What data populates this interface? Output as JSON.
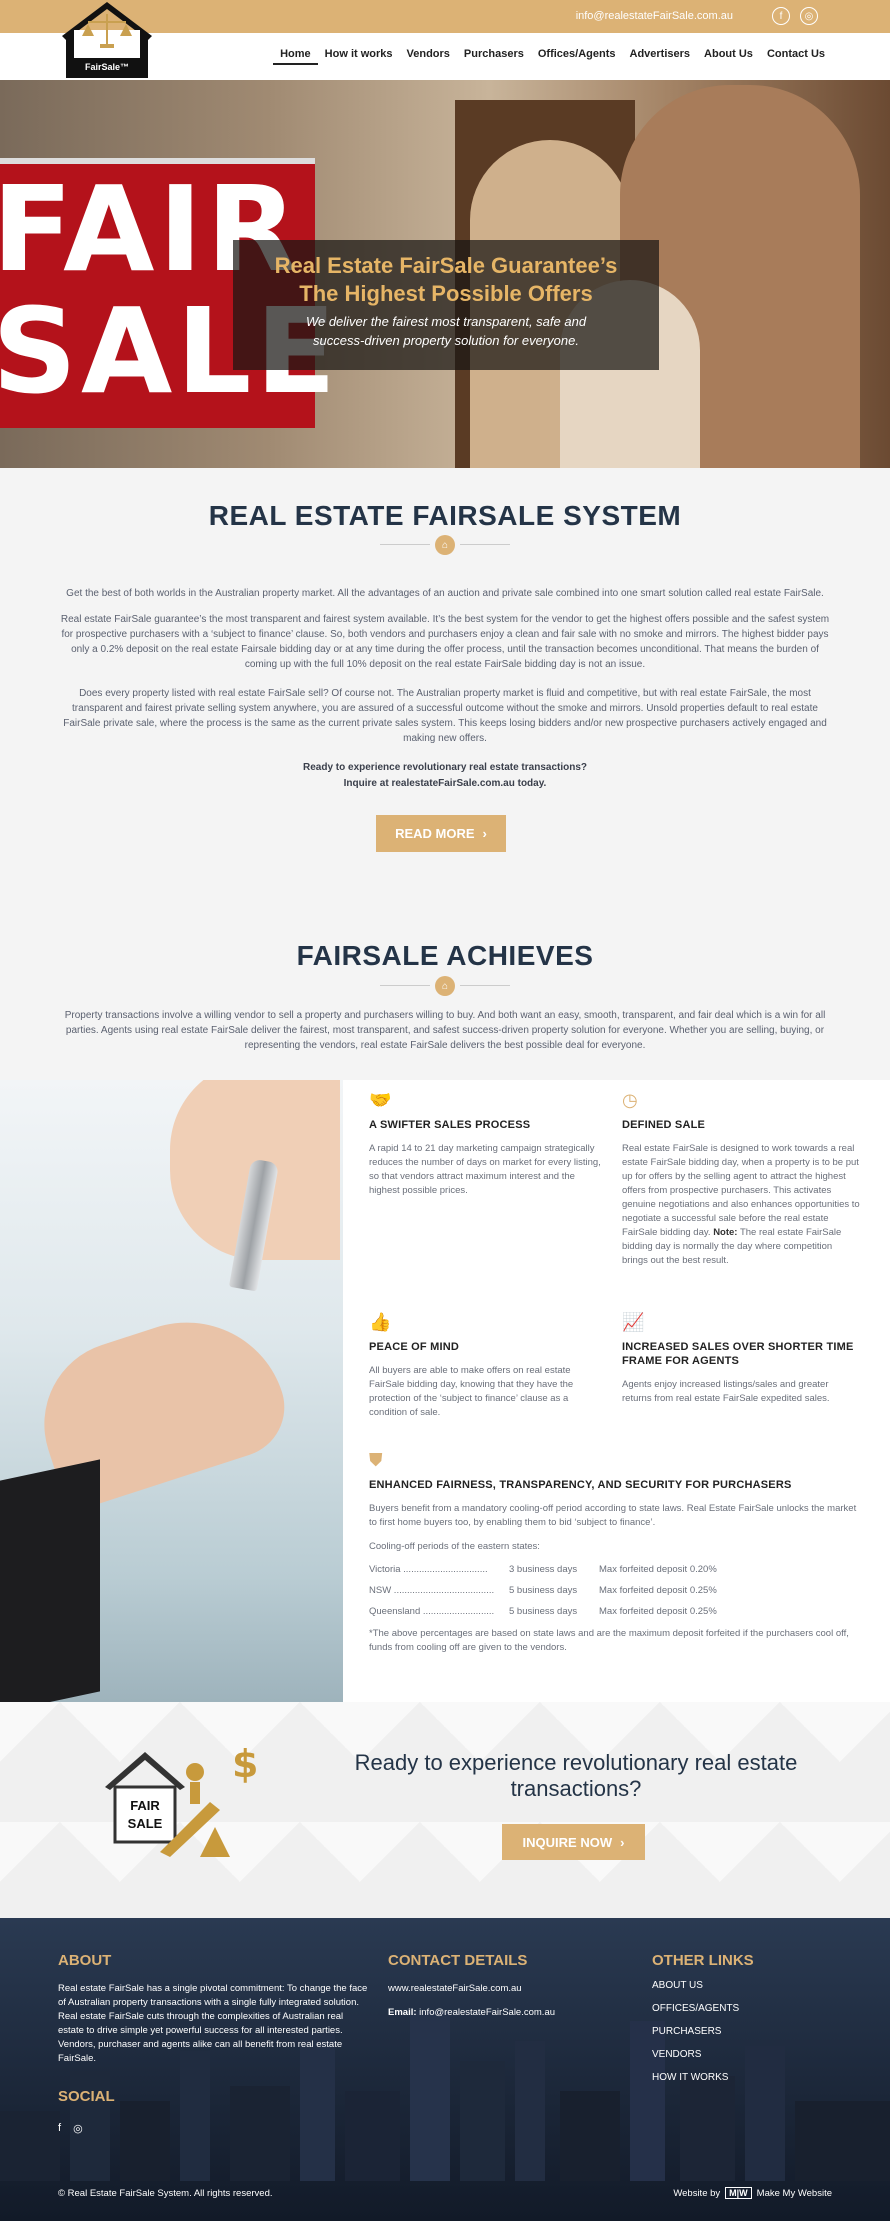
{
  "topbar": {
    "email": "info@realestateFairSale.com.au",
    "social_icons": [
      "facebook-icon",
      "instagram-icon"
    ]
  },
  "logo": {
    "text": "FairSale™"
  },
  "nav": {
    "items": [
      "Home",
      "How it works",
      "Vendors",
      "Purchasers",
      "Offices/Agents",
      "Advertisers",
      "About Us",
      "Contact Us"
    ],
    "active": "Home"
  },
  "hero": {
    "sign_line1": "FAIR",
    "sign_line2": "SALE",
    "title_line1": "Real Estate FairSale Guarantee’s",
    "title_line2": "The Highest Possible Offers",
    "subtitle_line1": "We deliver the fairest most transparent, safe and",
    "subtitle_line2": "success-driven property solution for everyone."
  },
  "system": {
    "title": "REAL ESTATE FAIRSALE SYSTEM",
    "p1": "Get the best of both worlds in the Australian property market. All the advantages of an auction and private sale combined into one smart solution called real estate FairSale.",
    "p2": "Real estate FairSale guarantee’s the most transparent and fairest system available. It’s the best system for the vendor to get the highest offers possible and the safest system for prospective purchasers with a ‘subject to finance’ clause. So, both vendors and purchasers enjoy a clean and fair sale with no smoke and mirrors. The highest bidder pays only a 0.2% deposit on the real estate Fairsale bidding day or at any time during the offer process, until the transaction becomes unconditional. That means the burden of coming up with the full 10% deposit on the real estate FairSale bidding day is not an issue.",
    "p3": "Does every property listed with real estate FairSale sell? Of course not. The Australian property market is fluid and competitive, but with real estate FairSale, the most transparent and fairest private selling system anywhere, you are assured of a successful outcome without the smoke and mirrors. Unsold properties default to real estate FairSale private sale, where the process is the same as the current private sales system. This keeps losing bidders and/or new prospective purchasers actively engaged and making new offers.",
    "bold1": "Ready to experience revolutionary real estate transactions?",
    "bold2": "Inquire at realestateFairSale.com.au today.",
    "button": "READ MORE"
  },
  "achieves": {
    "title": "FAIRSALE ACHIEVES",
    "intro": "Property transactions involve a willing vendor to sell a property and purchasers willing to buy. And both want an easy, smooth, transparent, and fair deal which is a win for all parties. Agents using real estate FairSale deliver the fairest, most transparent, and safest success-driven property solution for everyone. Whether you are selling, buying, or representing the vendors, real estate FairSale delivers the best possible deal for everyone."
  },
  "features": {
    "f1": {
      "icon": "handshake-icon",
      "title": "A SWIFTER SALES PROCESS",
      "desc": "A rapid 14 to 21 day marketing campaign strategically reduces the number of days on market for every listing, so that vendors attract maximum interest and the highest possible prices."
    },
    "f2": {
      "icon": "clock-icon",
      "title": "DEFINED SALE",
      "desc": "Real estate FairSale is designed to work towards a real estate FairSale bidding day, when a property is to be put up for offers by the selling agent to attract the highest offers from prospective purchasers. This activates genuine negotiations and also enhances opportunities to negotiate a successful sale before the real estate FairSale bidding day.",
      "note_label": "Note:",
      "note": "The real estate FairSale bidding day is normally the day where competition brings out the best result."
    },
    "f3": {
      "icon": "thumbs-up-icon",
      "title": "PEACE OF MIND",
      "desc": "All buyers are able to make offers on real estate FairSale bidding day, knowing that they have the protection of the ‘subject to finance’ clause as a condition of sale."
    },
    "f4": {
      "icon": "chart-icon",
      "title": "INCREASED SALES OVER SHORTER TIME FRAME FOR AGENTS",
      "desc": "Agents enjoy increased listings/sales and greater returns from real estate FairSale expedited sales."
    },
    "f5": {
      "icon": "shield-icon",
      "title": "ENHANCED FAIRNESS, TRANSPARENCY, AND SECURITY FOR PURCHASERS",
      "desc": "Buyers benefit from a mandatory cooling-off period according to state laws. Real Estate FairSale unlocks the market to first home buyers too, by enabling them to bid ‘subject to finance’.",
      "cooling_label": "Cooling-off periods of the eastern states:",
      "rows": [
        {
          "state": "Victoria ................................",
          "days": "3 business days",
          "max": "Max forfeited deposit 0.20%"
        },
        {
          "state": "NSW ......................................",
          "days": "5 business days",
          "max": "Max forfeited deposit 0.25%"
        },
        {
          "state": "Queensland ...........................",
          "days": "5 business days",
          "max": "Max forfeited deposit 0.25%"
        }
      ],
      "footnote": "*The above percentages are based on state laws and are the maximum deposit forfeited if the purchasers cool off, funds from cooling off are given to the vendors."
    }
  },
  "cta": {
    "image_text": "FAIR SALE",
    "line1": "Ready to experience revolutionary real estate",
    "line2": "transactions?",
    "button": "INQUIRE NOW"
  },
  "footer": {
    "about_title": "ABOUT",
    "about_text": "Real estate FairSale has a single pivotal commitment: To change the face of Australian property transactions with a single fully integrated solution. Real estate FairSale cuts through the complexities of Australian real estate to drive simple yet powerful success for all interested parties. Vendors, purchaser and agents alike can all benefit from real estate FairSale.",
    "contact_title": "CONTACT DETAILS",
    "website": "www.realestateFairSale.com.au",
    "email_label": "Email:",
    "email": "info@realestateFairSale.com.au",
    "links_title": "OTHER LINKS",
    "links": [
      "ABOUT US",
      "OFFICES/AGENTS",
      "PURCHASERS",
      "VENDORS",
      "HOW IT WORKS"
    ],
    "social_title": "SOCIAL",
    "copyright": "© Real Estate FairSale System. All rights reserved.",
    "credit_prefix": "Website by",
    "credit_name": "Make My Website"
  },
  "colors": {
    "gold": "#dcb275",
    "navy": "#243447"
  }
}
